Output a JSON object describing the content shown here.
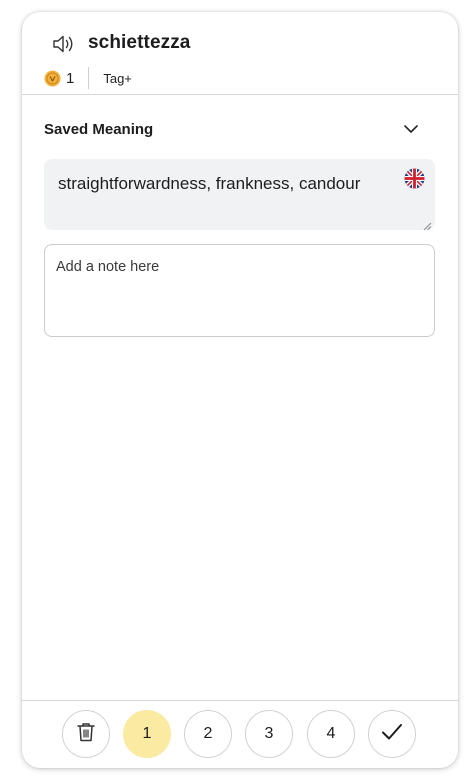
{
  "header": {
    "word": "schiettezza",
    "coin_count": "1",
    "tag_label": "Tag+"
  },
  "meaning": {
    "section_title": "Saved Meaning",
    "text": "straightforwardness, frankness, candour",
    "language_icon": "uk-flag-icon"
  },
  "note": {
    "placeholder": "Add a note here"
  },
  "footer": {
    "buttons": [
      {
        "type": "delete",
        "icon": "trash-icon"
      },
      {
        "type": "rating",
        "label": "1",
        "active": true
      },
      {
        "type": "rating",
        "label": "2",
        "active": false
      },
      {
        "type": "rating",
        "label": "3",
        "active": false
      },
      {
        "type": "rating",
        "label": "4",
        "active": false
      },
      {
        "type": "confirm",
        "icon": "check-icon"
      }
    ]
  },
  "colors": {
    "active_rating": "#faeaa2",
    "coin": "#f2b03c",
    "meaning_bg": "#f1f2f4"
  }
}
